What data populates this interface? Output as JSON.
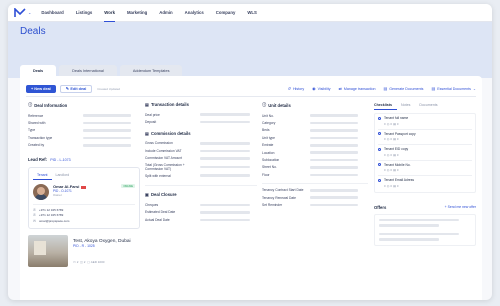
{
  "nav": {
    "items": [
      "Dashboard",
      "Listings",
      "Work",
      "Marketing",
      "Admin",
      "Analytics",
      "Company",
      "WLS"
    ],
    "active_index": 2
  },
  "page": {
    "title": "Deals"
  },
  "tabs": [
    "Deals",
    "Deals International",
    "Addendum Templates"
  ],
  "actions": {
    "new_deal": "+ New deal",
    "edit_deal": "Edit deal",
    "created": "Created Updated",
    "links": [
      {
        "icon": "history-icon",
        "glyph": "↺",
        "label": "History"
      },
      {
        "icon": "eye-icon",
        "glyph": "◉",
        "label": "Visibility"
      },
      {
        "icon": "transaction-icon",
        "glyph": "⇄",
        "label": "Manage transaction"
      },
      {
        "icon": "document-icon",
        "glyph": "▤",
        "label": "Generate Documents"
      },
      {
        "icon": "document-icon",
        "glyph": "▤",
        "label": "Essential Documents"
      }
    ]
  },
  "deal_information": {
    "title": "Deal Information",
    "fields": [
      "Reference",
      "Shared with",
      "Type",
      "Transaction type",
      "Created by"
    ]
  },
  "lead": {
    "label": "Lead Ref:",
    "pid": "PID - L-1073",
    "tabs": [
      "Tenant",
      "Landlord"
    ],
    "owner_name": "Omar Al-Farsi",
    "owner_pid": "PID - O-1071",
    "owner_role": "Owner",
    "badge": "ONLINE",
    "contacts": [
      {
        "icon": "phone-icon",
        "glyph": "✆",
        "value": "+971 12 345 6789"
      },
      {
        "icon": "phone-icon",
        "glyph": "✆",
        "value": "+971 12 345 6789"
      },
      {
        "icon": "mail-icon",
        "glyph": "✉",
        "value": "omar@propspace.com"
      }
    ]
  },
  "listing": {
    "title": "Test, Akoya Oxygen, Dubai",
    "pid": "PID - R - 1025",
    "meta_beds": "2",
    "meta_baths": "2",
    "meta_area": "AED 1000"
  },
  "transaction_details": {
    "title": "Transaction details",
    "fields": [
      "Deal price",
      "Deposit"
    ]
  },
  "commission_details": {
    "title": "Commission details",
    "fields": [
      "Gross Commission",
      "Include Commission VAT",
      "Commission VAT Amount",
      "Total (Gross Commission + Commission VAT)",
      "Split with external"
    ]
  },
  "deal_closure": {
    "title": "Deal Closure",
    "fields": [
      "Cheques",
      "Estimated Deal Date",
      "Actual Deal Date"
    ]
  },
  "unit_details": {
    "title": "Unit details",
    "fields": [
      "Unit No.",
      "Category",
      "Beds",
      "Unit type",
      "Emirate",
      "Location",
      "Sublocation",
      "Street No.",
      "Floor"
    ]
  },
  "tenancy": {
    "fields": [
      "Tenancy Contract Start Date",
      "Tenancy Renewal Date",
      "Set Reminder"
    ]
  },
  "checklist": {
    "tabs": [
      "Checklists",
      "Notes",
      "Documents"
    ],
    "items": [
      {
        "title": "Tenant full name",
        "meta": "0 ◎ 0 ▤ 0"
      },
      {
        "title": "Tenant Passport copy",
        "meta": "0 ◎ 0 ▤ 0"
      },
      {
        "title": "Tenant EID copy",
        "meta": "0 ◎ 0 ▤ 0"
      },
      {
        "title": "Tenant Mobile No.",
        "meta": "0 ◎ 0 ▤ 0"
      },
      {
        "title": "Tenant Email Adress",
        "meta": "0 ◎ 0 ▤ 0"
      }
    ]
  },
  "offers": {
    "title": "Offers",
    "link": "+ Send me new offer"
  },
  "colors": {
    "accent": "#2f55d4",
    "header_bg": "#dde5f5",
    "page_bg": "#e9edf3"
  }
}
